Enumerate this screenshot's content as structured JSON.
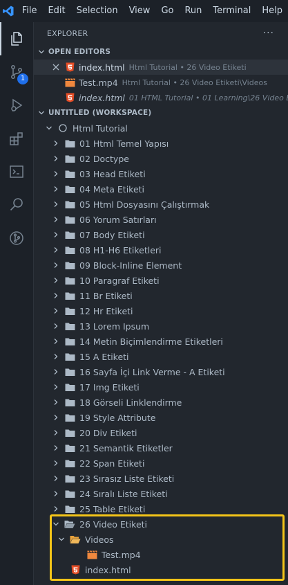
{
  "menu": [
    "File",
    "Edit",
    "Selection",
    "View",
    "Go",
    "Run",
    "Terminal",
    "Help"
  ],
  "activity": {
    "scm_badge": "1"
  },
  "explorer": {
    "title": "EXPLORER",
    "more": "···",
    "open_editors": {
      "title": "OPEN EDITORS",
      "items": [
        {
          "name": "index.html",
          "desc": "Html Tutorial • 26 Video Etiketi",
          "icon": "html5-icon",
          "selected": true,
          "close": true
        },
        {
          "name": "Test.mp4",
          "desc": "Html Tutorial • 26 Video Etiketi\\Videos",
          "icon": "video-file-icon"
        },
        {
          "name": "index.html",
          "desc": "01 HTML Tutorial • 01 Learning\\26 Video Eti",
          "icon": "html5-icon",
          "italic": true
        }
      ]
    },
    "workspace": {
      "title": "UNTITLED (WORKSPACE)",
      "root": "Html Tutorial",
      "folders": [
        "01 Html Temel Yapısı",
        "02 Doctype",
        "03 Head Etiketi",
        "04 Meta Etiketi",
        "05 Html Dosyasını Çalıştırmak",
        "06 Yorum Satırları",
        "07 Body Etiketi",
        "08 H1-H6 Etiketleri",
        "09 Block-Inline Element",
        "10 Paragraf Etiketi",
        "11 Br Etiketi",
        "12 Hr Etiketi",
        "13 Lorem Ipsum",
        "14 Metin Biçimlendirme Etiketleri",
        "15 A Etiketi",
        "16 Sayfa İçi Link Verme - A Etiketi",
        "17 Img Etiketi",
        "18 Görseli Linklendirme",
        "19 Style Attribute",
        "20 Div Etiketi",
        "21 Semantik Etiketler",
        "22 Span Etiketi",
        "23 Sırasız Liste Etiketi",
        "24 Sıralı Liste Etiketi",
        "25 Table Etiketi"
      ],
      "open_folder": "26 Video Etiketi",
      "subfolder": "Videos",
      "subfile": "Test.mp4",
      "file": "index.html"
    }
  },
  "colors": {
    "accent": "#1f6feb",
    "highlight": "#f5c518",
    "html": "#e44d26",
    "video": "#f0883e",
    "folder": "#adbac7"
  }
}
